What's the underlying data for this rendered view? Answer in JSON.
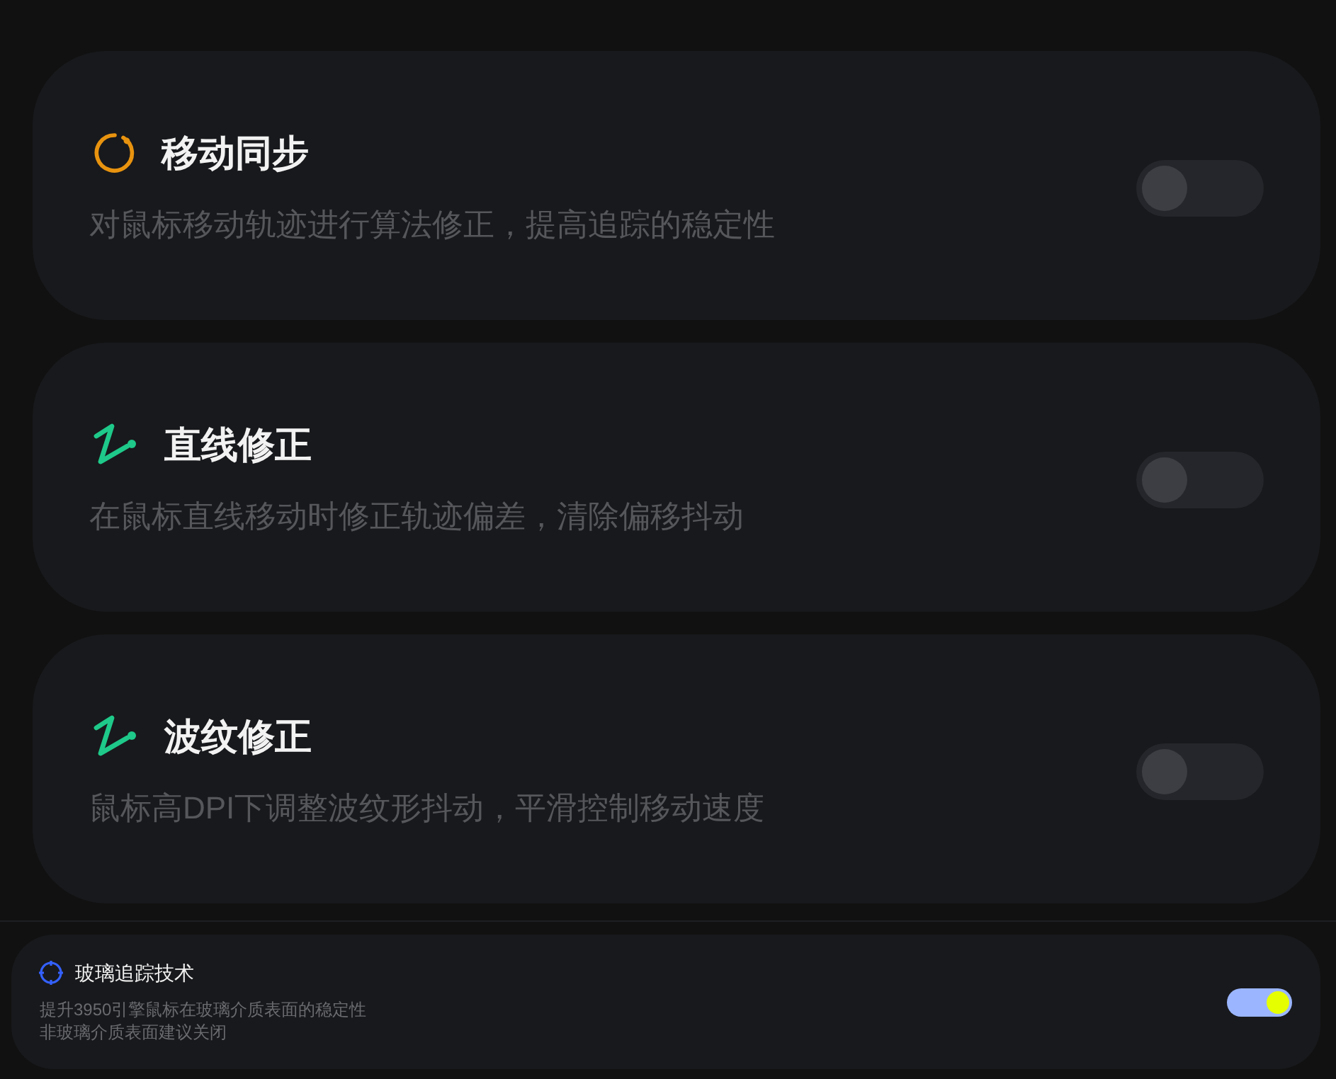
{
  "features": [
    {
      "kind": "ring",
      "title": "移动同步",
      "description": "对鼠标移动轨迹进行算法修正，提高追踪的稳定性",
      "on": false
    },
    {
      "kind": "zigzag",
      "title": "直线修正",
      "description": "在鼠标直线移动时修正轨迹偏差，清除偏移抖动",
      "on": false
    },
    {
      "kind": "zigzag",
      "title": "波纹修正",
      "description": "鼠标高DPI下调整波纹形抖动，平滑控制移动速度",
      "on": false
    }
  ],
  "glass_tracking": {
    "title": "玻璃追踪技术",
    "description_lines": [
      "提升3950引擎鼠标在玻璃介质表面的稳定性",
      "非玻璃介质表面建议关闭"
    ],
    "on": true
  }
}
